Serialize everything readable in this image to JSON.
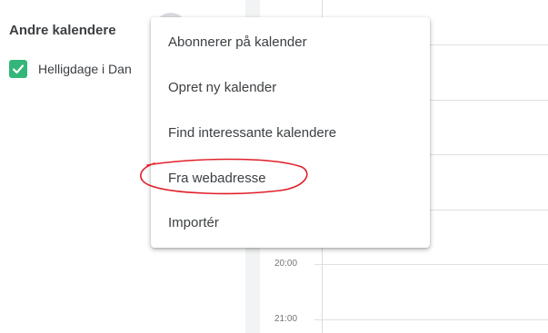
{
  "sidebar": {
    "section_title": "Andre kalendere",
    "calendars": [
      {
        "label": "Helligdage i Dan",
        "checked": true,
        "color": "#33b679"
      }
    ]
  },
  "menu": {
    "items": [
      {
        "label": "Abonnerer på kalender"
      },
      {
        "label": "Opret ny kalender"
      },
      {
        "label": "Find interessante kalendere"
      },
      {
        "label": "Fra webadresse",
        "highlighted_by_annotation": true
      },
      {
        "label": "Importér"
      }
    ]
  },
  "grid": {
    "times": [
      "20:00",
      "21:00"
    ]
  },
  "colors": {
    "annotation": "#e0202a",
    "checkbox": "#33b679"
  },
  "icons": {
    "checkbox": "check-icon"
  }
}
